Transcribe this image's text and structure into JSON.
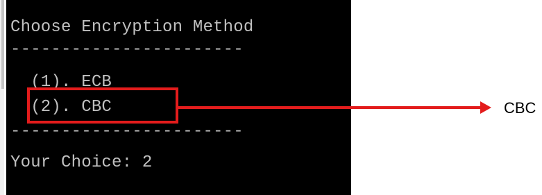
{
  "terminal": {
    "title_line": "Choose Encryption Method",
    "separator_top": "-----------------------",
    "option_1": "  (1). ECB",
    "option_2": "  (2). CBC",
    "separator_bottom": "-----------------------",
    "prompt": "Your Choice: 2"
  },
  "annotation": {
    "callout_label": "CBC",
    "highlight_color": "#e31c1c"
  }
}
